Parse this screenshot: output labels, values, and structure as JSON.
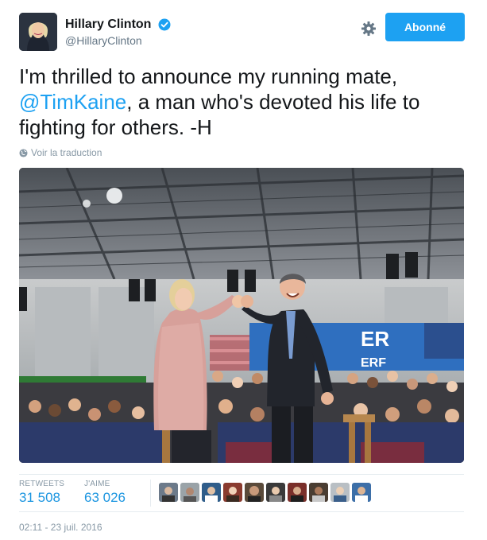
{
  "user": {
    "display_name": "Hillary Clinton",
    "handle": "@HillaryClinton",
    "verified": true
  },
  "actions": {
    "follow_label": "Abonné",
    "settings_icon": "gear-icon"
  },
  "tweet": {
    "text_before": "I'm thrilled to announce my running mate, ",
    "mention": "@TimKaine",
    "text_after": ", a man who's devoted his life to fighting for others. -H",
    "translate_label": "Voir la traduction"
  },
  "photo": {
    "sign_text": "ER",
    "sign_text2": "ERF"
  },
  "stats": {
    "retweets_label": "RETWEETS",
    "retweets_value": "31 508",
    "likes_label": "J'AIME",
    "likes_value": "63 026"
  },
  "likers": [
    "liker-1",
    "liker-2",
    "liker-3",
    "liker-4",
    "liker-5",
    "liker-6",
    "liker-7",
    "liker-8",
    "liker-9",
    "liker-10"
  ],
  "timestamp": "02:11 - 23 juil. 2016",
  "colors": {
    "accent": "#1da1f2",
    "link": "#1b95e0",
    "muted": "#8899a6"
  }
}
